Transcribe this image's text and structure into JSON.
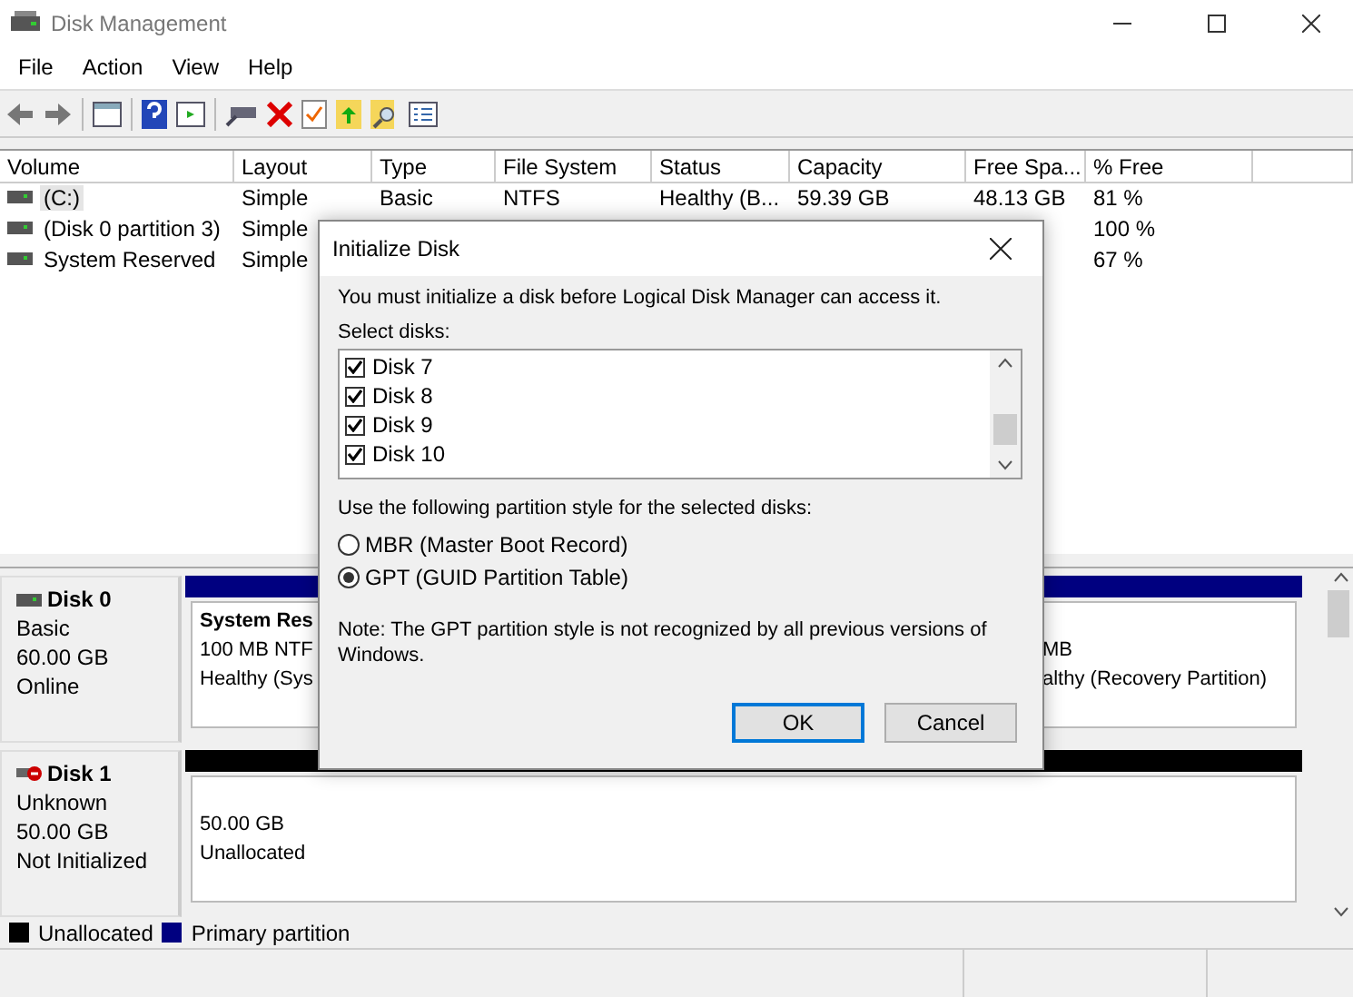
{
  "window": {
    "title": "Disk Management"
  },
  "menu": [
    "File",
    "Action",
    "View",
    "Help"
  ],
  "volumes": {
    "columns": [
      "Volume",
      "Layout",
      "Type",
      "File System",
      "Status",
      "Capacity",
      "Free Spa...",
      "% Free"
    ],
    "rows": [
      {
        "volume": "(C:)",
        "layout": "Simple",
        "type": "Basic",
        "file_system": "NTFS",
        "status": "Healthy (B...",
        "capacity": "59.39 GB",
        "free_space": "48.13 GB",
        "pct_free": "81 %",
        "selected": true
      },
      {
        "volume": "(Disk 0 partition 3)",
        "layout": "Simple",
        "pct_free": "100 %",
        "selected": false
      },
      {
        "volume": "System Reserved",
        "layout": "Simple",
        "pct_free": "67 %",
        "selected": false
      }
    ]
  },
  "disks": [
    {
      "name": "Disk 0",
      "kind": "online",
      "type": "Basic",
      "size": "60.00 GB",
      "status": "Online",
      "partitions": [
        {
          "kind": "primary",
          "name": "System Res",
          "lines": [
            "100 MB NTF",
            "Healthy (Sys"
          ]
        },
        {
          "kind": "primary",
          "lines": [
            "MB",
            "althy (Recovery Partition)"
          ]
        }
      ]
    },
    {
      "name": "Disk 1",
      "kind": "error",
      "type": "Unknown",
      "size": "50.00 GB",
      "status": "Not Initialized",
      "partitions": [
        {
          "kind": "unallocated",
          "lines": [
            "50.00 GB",
            "Unallocated"
          ]
        }
      ]
    }
  ],
  "legend": [
    {
      "label": "Unallocated",
      "color": "#000000"
    },
    {
      "label": "Primary partition",
      "color": "#000080"
    }
  ],
  "dialog": {
    "title": "Initialize Disk",
    "message": "You must initialize a disk before Logical Disk Manager can access it.",
    "select_label": "Select disks:",
    "disks": [
      {
        "label": "Disk 7",
        "checked": true
      },
      {
        "label": "Disk 8",
        "checked": true
      },
      {
        "label": "Disk 9",
        "checked": true
      },
      {
        "label": "Disk 10",
        "checked": true
      }
    ],
    "style_label": "Use the following partition style for the selected disks:",
    "styles": [
      {
        "label": "MBR (Master Boot Record)",
        "selected": false
      },
      {
        "label": "GPT (GUID Partition Table)",
        "selected": true
      }
    ],
    "note": "Note: The GPT partition style is not recognized by all previous versions of Windows.",
    "buttons": [
      {
        "label": "OK",
        "default": true
      },
      {
        "label": "Cancel",
        "default": false
      }
    ]
  }
}
